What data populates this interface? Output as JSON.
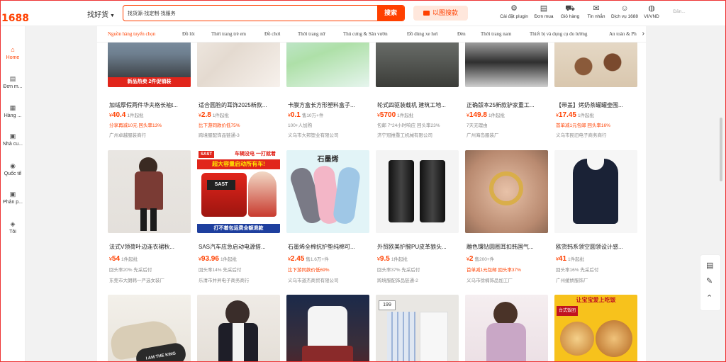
{
  "header": {
    "logo": "1688",
    "search_category": "找好货",
    "search_value": "找货源·找定制·找服务",
    "search_button": "搜索",
    "image_search_button": "以图搜款",
    "icons": [
      {
        "label": "Cài đặt plugin",
        "icon": "puzzle-icon"
      },
      {
        "label": "Đơn mua",
        "icon": "clipboard-icon"
      },
      {
        "label": "Giỏ hàng",
        "icon": "cart-icon"
      },
      {
        "label": "Tin nhắn",
        "icon": "message-icon"
      },
      {
        "label": "Dịch vụ 1688",
        "icon": "user-icon"
      },
      {
        "label": "VI/VND",
        "icon": "globe-icon"
      },
      {
        "label": "Đăn...",
        "icon": "user-login"
      }
    ]
  },
  "categories": [
    "Nguồn hàng tuyển chọn",
    "Đồ lót",
    "Thời trang trẻ em",
    "Đồ chơi",
    "Thời trang nữ",
    "Thú cưng & Sân vườn",
    "Đồ dùng xe hơi",
    "Đèn",
    "Thời trang nam",
    "Thiết bị và dụng cụ đo lường",
    "An toàn & Ph"
  ],
  "sidebar": [
    {
      "label": "Home",
      "icon": "home-icon"
    },
    {
      "label": "Đơn m...",
      "icon": "order-icon"
    },
    {
      "label": "Hàng ...",
      "icon": "grid-icon"
    },
    {
      "label": "Nhà cu...",
      "icon": "store-icon"
    },
    {
      "label": "Quốc tế",
      "icon": "globe-icon"
    },
    {
      "label": "Phản p...",
      "icon": "feedback-icon"
    },
    {
      "label": "Tôi",
      "icon": "me-icon"
    }
  ],
  "products_row1": [
    {
      "title": "加绒厚假两件华夫格长袖t...",
      "price": "40.4",
      "unit": "1件起批",
      "line2": "分享再减10元 回头率13%",
      "seller": "广州卓越服装商行",
      "banner": "新品热卖  2件促销装"
    },
    {
      "title": "适合圆脸的耳饰2025新款...",
      "price": "2.8",
      "unit": "1件起批",
      "line2": "比下游同款价低75%",
      "seller": "跨境服配饰品链通-3",
      "banner": ""
    },
    {
      "title": "卡膜方盒长方形塑料盒子...",
      "price": "0.1",
      "unit": "售10万+件",
      "line2": "100+人加购",
      "seller": "义乌市大邦塑业有限公司",
      "banner": ""
    },
    {
      "title": "轮式四驱装载机 建筑工地...",
      "price": "5700",
      "unit": "1件起批",
      "line2": "包邮 7*24小时响应 回头率23%",
      "seller": "济宁冠推重工机械有限公司",
      "banner": ""
    },
    {
      "title": "正确版本25新款驴家重工...",
      "price": "149.8",
      "unit": "1件起批",
      "line2": "7天无理由",
      "seller": "广州海岛服装厂",
      "banner": ""
    },
    {
      "title": "【带盖】烤奶茶罐罐壶围...",
      "price": "17.45",
      "unit": "1件起批",
      "line2": "首单减1元包邮 回头率16%",
      "seller": "义乌市民旧电子商务商行",
      "banner": ""
    }
  ],
  "products_row2": [
    {
      "title": "法式V领荷叶边连衣裙秋...",
      "price": "54",
      "unit": "1件起批",
      "line2": "回头率20% 先采后付",
      "seller": "东莞市大朗韩一严选女装厂"
    },
    {
      "title": "SAS汽车应急启动电源搭...",
      "price": "93.96",
      "unit": "1件起批",
      "line2": "回头率14% 先采后付",
      "seller": "乐清市并昇电子商务商行"
    },
    {
      "title": "石墨烯全棉抗护垫纯棉可...",
      "price": "2.45",
      "unit": "售1.6万+件",
      "line2": "比下游同款价低69%",
      "seller": "义乌市道杰商贸有限公司"
    },
    {
      "title": "外贸欧美护腕PU皮革狼头...",
      "price": "9.5",
      "unit": "1件起批",
      "line2": "回头率37% 先采后付",
      "seller": "跨境服配饰品链通-2"
    },
    {
      "title": "雕色镶钻圆圈耳扣韩国气...",
      "price": "2",
      "unit": "售200+件",
      "line2": "首单减1元包邮 回头率37%",
      "seller": "义乌市徐楠饰品加工厂"
    },
    {
      "title": "欧货韩系领空圆领设计感...",
      "price": "41",
      "unit": "1件起批",
      "line2": "回头率16% 先采后付",
      "seller": "广州缓娇服饰厂"
    }
  ],
  "thumb_texts": {
    "sast_top": "车辆没电 一打就着",
    "sast_mid": "超大容量启动所有车!",
    "sast_brand": "SAST",
    "sast_bottom": "打不着包运费全额退款",
    "graphene": "石墨烯",
    "tag_199": "199",
    "food_top": "让宝宝爱上吃饭",
    "food_sub": "台式饭团",
    "shoe_text": "I AM THE KING"
  },
  "colors": {
    "accent": "#ff4000",
    "promo": "#ff4000"
  }
}
